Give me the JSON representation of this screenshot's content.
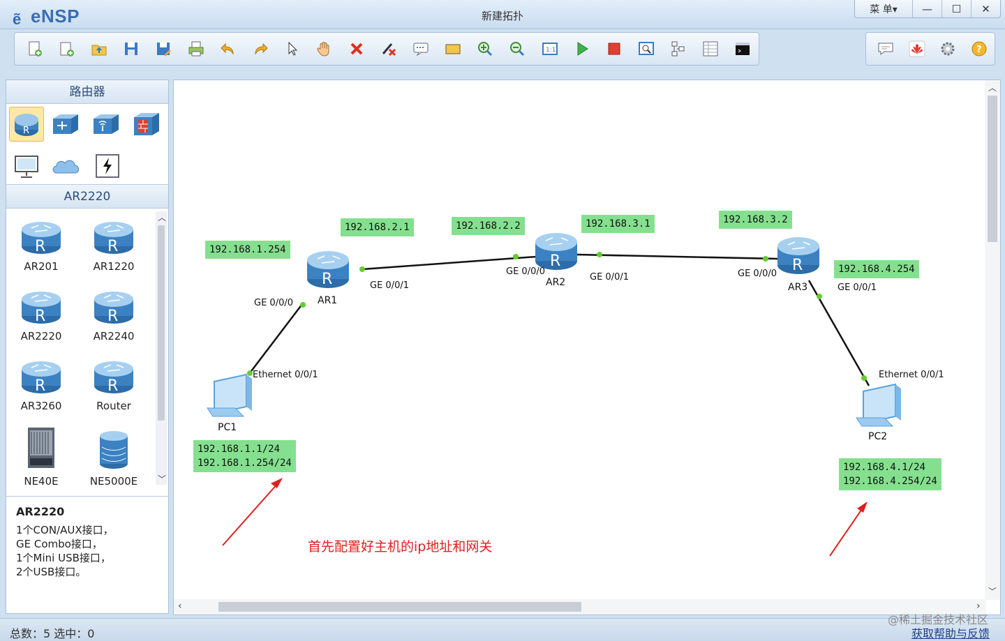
{
  "app": {
    "logo": "eNSP",
    "title": "新建拓扑"
  },
  "window_controls": {
    "menu": "菜 单▾",
    "minimize": "—",
    "maximize": "☐",
    "close": "✕"
  },
  "toolbar": {
    "buttons": [
      "new-topology",
      "new-example",
      "open",
      "save",
      "save-as",
      "print",
      "undo",
      "redo",
      "select",
      "pan",
      "delete",
      "delete-link",
      "text",
      "rectangle",
      "zoom-in",
      "zoom-out",
      "fit",
      "start",
      "stop",
      "capture",
      "topology",
      "table",
      "cli"
    ],
    "right_buttons": [
      "chat",
      "huawei",
      "settings",
      "help"
    ]
  },
  "left_panel": {
    "header": "路由器",
    "subheader": "AR2220",
    "categories": [
      "router",
      "switch",
      "wlan",
      "firewall",
      "pc",
      "cloud",
      "other"
    ],
    "models": [
      {
        "label": "AR201"
      },
      {
        "label": "AR1220"
      },
      {
        "label": "AR2220"
      },
      {
        "label": "AR2240"
      },
      {
        "label": "AR3260"
      },
      {
        "label": "Router"
      },
      {
        "label": "NE40E"
      },
      {
        "label": "NE5000E"
      }
    ],
    "description": {
      "title": "AR2220",
      "lines": [
        "1个CON/AUX接口，",
        "GE Combo接口，",
        "1个Mini USB接口，",
        "2个USB接口。"
      ]
    }
  },
  "topology": {
    "devices": {
      "ar1": "AR1",
      "ar2": "AR2",
      "ar3": "AR3",
      "pc1": "PC1",
      "pc2": "PC2"
    },
    "ports": {
      "ar1_ge000": "GE 0/0/0",
      "ar1_ge001": "GE 0/0/1",
      "ar2_ge000": "GE 0/0/0",
      "ar2_ge001": "GE 0/0/1",
      "ar3_ge000": "GE 0/0/0",
      "ar3_ge001": "GE 0/0/1",
      "pc1_eth": "Ethernet 0/0/1",
      "pc2_eth": "Ethernet 0/0/1"
    },
    "ips": {
      "ar1_ge000": "192.168.1.254",
      "ar1_ge001": "192.168.2.1",
      "ar2_ge000": "192.168.2.2",
      "ar2_ge001": "192.168.3.1",
      "ar3_ge000": "192.168.3.2",
      "ar3_ge001": "192.168.4.254",
      "pc1": "192.168.1.1/24\n192.168.1.254/24",
      "pc2": "192.168.4.1/24\n192.168.4.254/24"
    },
    "note": "首先配置好主机的ip地址和网关"
  },
  "status": {
    "text": "总数：5  选中：0",
    "watermark": "@稀土掘金技术社区",
    "help_link": "获取帮助与反馈"
  },
  "colors": {
    "ip_label_bg": "#84e08e",
    "link_dot": "#66cc33",
    "note": "#e02020",
    "arrow": "#e02020"
  }
}
